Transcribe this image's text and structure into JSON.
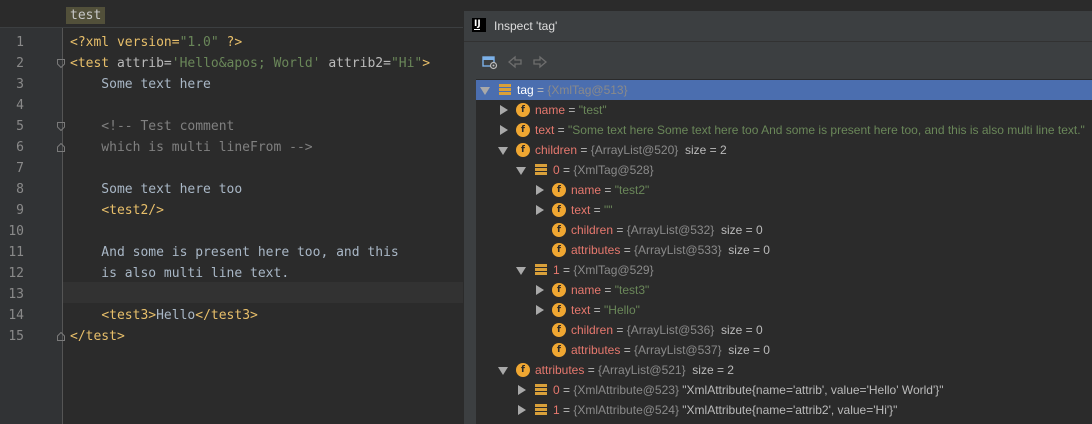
{
  "editor": {
    "breadcrumb": "test",
    "line_numbers": [
      "1",
      "2",
      "3",
      "4",
      "5",
      "6",
      "7",
      "8",
      "9",
      "10",
      "11",
      "12",
      "13",
      "14",
      "15"
    ],
    "lines": [
      [
        {
          "t": "<?xml version=",
          "c": "tag"
        },
        {
          "t": "\"1.0\"",
          "c": "val"
        },
        {
          "t": " ?>",
          "c": "tag"
        }
      ],
      [
        {
          "t": "<test ",
          "c": "tag"
        },
        {
          "t": "attrib=",
          "c": "attr"
        },
        {
          "t": "'Hello",
          "c": "val"
        },
        {
          "t": "&apos;",
          "c": "ent"
        },
        {
          "t": " World'",
          "c": "val"
        },
        {
          "t": " attrib2=",
          "c": "attr"
        },
        {
          "t": "\"Hi\"",
          "c": "val"
        },
        {
          "t": ">",
          "c": "tag"
        }
      ],
      [
        {
          "t": "    Some text here",
          "c": "txt"
        }
      ],
      [],
      [
        {
          "t": "    <!-- Test comment",
          "c": "cmt"
        }
      ],
      [
        {
          "t": "    which is multi lineFrom -->",
          "c": "cmt"
        }
      ],
      [],
      [
        {
          "t": "    Some text here too",
          "c": "txt"
        }
      ],
      [
        {
          "t": "    ",
          "c": "txt"
        },
        {
          "t": "<test2/>",
          "c": "tag"
        }
      ],
      [],
      [
        {
          "t": "    And some is present here too, and this",
          "c": "txt"
        }
      ],
      [
        {
          "t": "    is also multi line text.",
          "c": "txt"
        }
      ],
      [],
      [
        {
          "t": "    ",
          "c": "txt"
        },
        {
          "t": "<test3>",
          "c": "tag"
        },
        {
          "t": "Hello",
          "c": "txt"
        },
        {
          "t": "</test3>",
          "c": "tag"
        }
      ],
      [
        {
          "t": "</test>",
          "c": "tag"
        }
      ]
    ]
  },
  "inspector": {
    "title": "Inspect 'tag'",
    "toolbar": {
      "icons": [
        "view-settings-icon",
        "back-arrow-icon",
        "forward-arrow-icon"
      ]
    },
    "rows": [
      {
        "indent": 0,
        "arrow": "open",
        "icon": "object",
        "name": "tag",
        "type": "{XmlTag@513}",
        "value": "",
        "size": "",
        "selected": true
      },
      {
        "indent": 1,
        "arrow": "closed",
        "icon": "field",
        "name": "name",
        "type": "",
        "value": "\"test\"",
        "size": ""
      },
      {
        "indent": 1,
        "arrow": "closed",
        "icon": "field",
        "name": "text",
        "type": "",
        "value": "\"Some text here Some text here too And some is present here too, and this is also multi line text.\"",
        "size": ""
      },
      {
        "indent": 1,
        "arrow": "open",
        "icon": "field",
        "name": "children",
        "type": "{ArrayList@520}",
        "value": "",
        "size": "size = 2"
      },
      {
        "indent": 2,
        "arrow": "open",
        "icon": "object",
        "name": "0",
        "type": "{XmlTag@528}",
        "value": "",
        "size": ""
      },
      {
        "indent": 3,
        "arrow": "closed",
        "icon": "field",
        "name": "name",
        "type": "",
        "value": "\"test2\"",
        "size": ""
      },
      {
        "indent": 3,
        "arrow": "closed",
        "icon": "field",
        "name": "text",
        "type": "",
        "value": "\"\"",
        "size": ""
      },
      {
        "indent": 3,
        "arrow": "none",
        "icon": "field",
        "name": "children",
        "type": "{ArrayList@532}",
        "value": "",
        "size": "size = 0"
      },
      {
        "indent": 3,
        "arrow": "none",
        "icon": "field",
        "name": "attributes",
        "type": "{ArrayList@533}",
        "value": "",
        "size": "size = 0"
      },
      {
        "indent": 2,
        "arrow": "open",
        "icon": "object",
        "name": "1",
        "type": "{XmlTag@529}",
        "value": "",
        "size": ""
      },
      {
        "indent": 3,
        "arrow": "closed",
        "icon": "field",
        "name": "name",
        "type": "",
        "value": "\"test3\"",
        "size": ""
      },
      {
        "indent": 3,
        "arrow": "closed",
        "icon": "field",
        "name": "text",
        "type": "",
        "value": "\"Hello\"",
        "size": ""
      },
      {
        "indent": 3,
        "arrow": "none",
        "icon": "field",
        "name": "children",
        "type": "{ArrayList@536}",
        "value": "",
        "size": "size = 0"
      },
      {
        "indent": 3,
        "arrow": "none",
        "icon": "field",
        "name": "attributes",
        "type": "{ArrayList@537}",
        "value": "",
        "size": "size = 0"
      },
      {
        "indent": 1,
        "arrow": "open",
        "icon": "field",
        "name": "attributes",
        "type": "{ArrayList@521}",
        "value": "",
        "size": "size = 2"
      },
      {
        "indent": 2,
        "arrow": "closed",
        "icon": "object",
        "name": "0",
        "type": "{XmlAttribute@523}",
        "value": "\"XmlAttribute{name='attrib', value='Hello' World'}\"",
        "size": ""
      },
      {
        "indent": 2,
        "arrow": "closed",
        "icon": "object",
        "name": "1",
        "type": "{XmlAttribute@524}",
        "value": "\"XmlAttribute{name='attrib2', value='Hi'}\"",
        "size": ""
      }
    ]
  },
  "colors": {
    "editor_bg": "#2b2b2b",
    "tag": "#e8bf6a",
    "string": "#6a8759",
    "comment": "#808080",
    "selection": "#4b6eaf",
    "field_name": "#e6786e"
  }
}
